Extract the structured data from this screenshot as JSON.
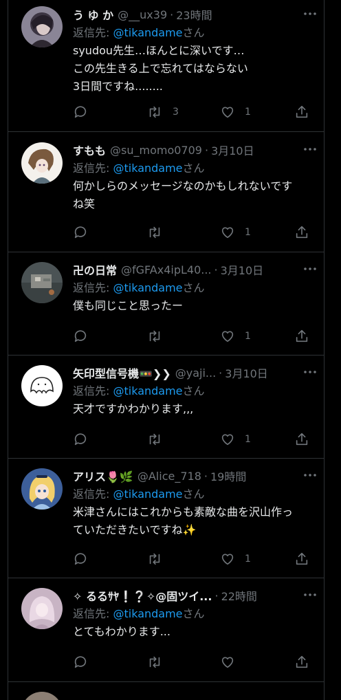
{
  "reply_prefix": "返信先: ",
  "reply_suffix": "さん",
  "tweets": [
    {
      "name": "う ゆ か",
      "handle": "@__ux39",
      "time": "23時間",
      "reply_to": "@tikandame",
      "text": "syudou先生…ほんとに深いです…\nこの先生きる上で忘れてはならない\n3日間ですね........",
      "retweets": "3",
      "likes": "1"
    },
    {
      "name": "すもも",
      "handle": "@su_momo0709",
      "time": "3月10日",
      "reply_to": "@tikandame",
      "text": "何かしらのメッセージなのかもしれないです\nね笑",
      "retweets": "",
      "likes": "1"
    },
    {
      "name": "卍の日常",
      "handle": "@fGFAx4ipL40...",
      "time": "3月10日",
      "reply_to": "@tikandame",
      "text": "僕も同じこと思ったー",
      "retweets": "",
      "likes": "1"
    },
    {
      "name": "矢印型信号機🚥❯❯",
      "handle": "@yaji...",
      "time": "3月10日",
      "reply_to": "@tikandame",
      "text": "天才ですかわかります,,,",
      "retweets": "",
      "likes": "1"
    },
    {
      "name": "アリス🌷🌿",
      "handle": "@Alice_718",
      "time": "19時間",
      "reply_to": "@tikandame",
      "text": "米津さんにはこれからも素敵な曲を沢山作っ\nていただきたいですね✨",
      "retweets": "",
      "likes": "1"
    },
    {
      "name": "✧ るるｻﾔ❕❔✧@固ツイ...",
      "handle": "",
      "time": "22時間",
      "reply_to": "@tikandame",
      "text": "とてもわかります...",
      "retweets": "",
      "likes": ""
    }
  ],
  "icons": {
    "more": "more-dots-icon",
    "reply": "reply-bubble-icon",
    "retweet": "retweet-arrows-icon",
    "like": "heart-outline-icon",
    "share": "share-upload-icon"
  },
  "colors": {
    "background": "#000000",
    "text": "#e7e9ea",
    "secondary": "#71767b",
    "mention": "#1d9bf0",
    "divider": "#2f3336"
  }
}
